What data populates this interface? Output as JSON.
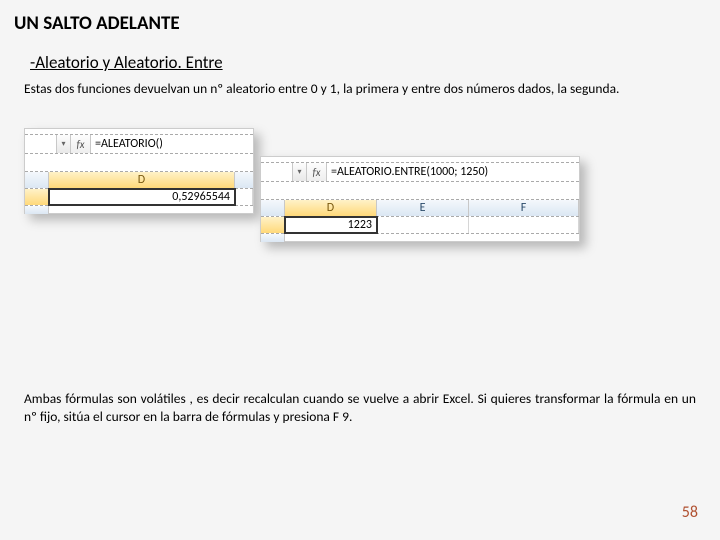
{
  "title": "UN SALTO ADELANTE",
  "subtitle": "-Aleatorio y Aleatorio. Entre",
  "body1": "Estas dos funciones devuelvan un nº aleatorio entre 0 y 1, la primera y entre dos números dados, la segunda.",
  "body2": "Ambas fórmulas son volátiles , es decir  recalculan cuando se vuelve a abrir Excel. Si quieres transformar la fórmula en un nº fijo, sitúa el cursor en la barra de fórmulas y presiona F 9.",
  "page_number": "58",
  "snip1": {
    "fx": "fx",
    "formula": "=ALEATORIO()",
    "col_header": "D",
    "value": "0,52965544"
  },
  "snip2": {
    "fx": "fx",
    "formula": "=ALEATORIO.ENTRE(1000; 1250)",
    "cols": [
      "D",
      "E",
      "F"
    ],
    "sel_col_index": 0,
    "value": "1223"
  }
}
